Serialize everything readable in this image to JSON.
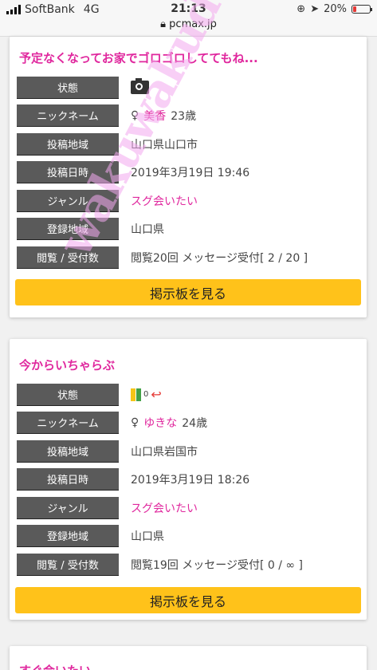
{
  "status_bar": {
    "carrier": "SoftBank",
    "network": "4G",
    "time": "21:13",
    "url": "pcmax.jp",
    "battery": "20%",
    "battery_color": "#e53935"
  },
  "posts": [
    {
      "title": "予定なくなってお家でゴロゴロしててもね...",
      "rows": {
        "status_label": "状態",
        "status_icon": "camera-icon",
        "nickname_label": "ニックネーム",
        "gender": "♀",
        "name": "美香",
        "age": "23歳",
        "area_label": "投稿地域",
        "area": "山口県山口市",
        "date_label": "投稿日時",
        "date": "2019年3月19日 19:46",
        "genre_label": "ジャンル",
        "genre": "スグ会いたい",
        "reg_label": "登録地域",
        "reg": "山口県",
        "views_label": "閲覧 / 受付数",
        "views": "閲覧20回 メッセージ受付[ 2 / 20 ]"
      },
      "button": "掲示板を見る"
    },
    {
      "title": "今からいちゃらぶ",
      "rows": {
        "status_label": "状態",
        "status_icon": "beginner-leaf-icon",
        "status_count": "0",
        "nickname_label": "ニックネーム",
        "gender": "♀",
        "name": "ゆきな",
        "age": "24歳",
        "area_label": "投稿地域",
        "area": "山口県岩国市",
        "date_label": "投稿日時",
        "date": "2019年3月19日 18:26",
        "genre_label": "ジャンル",
        "genre": "スグ会いたい",
        "reg_label": "登録地域",
        "reg": "山口県",
        "views_label": "閲覧 / 受付数",
        "views": "閲覧19回 メッセージ受付[ 0 / ∞ ]"
      },
      "button": "掲示板を見る"
    },
    {
      "title": "すぐ会いたい"
    }
  ],
  "watermark": "wakuwakudeaisaimesaoqq.net",
  "colors": {
    "accent_pink": "#e0289e",
    "button_yellow": "#ffc21a",
    "label_gray": "#5a5a5a"
  }
}
